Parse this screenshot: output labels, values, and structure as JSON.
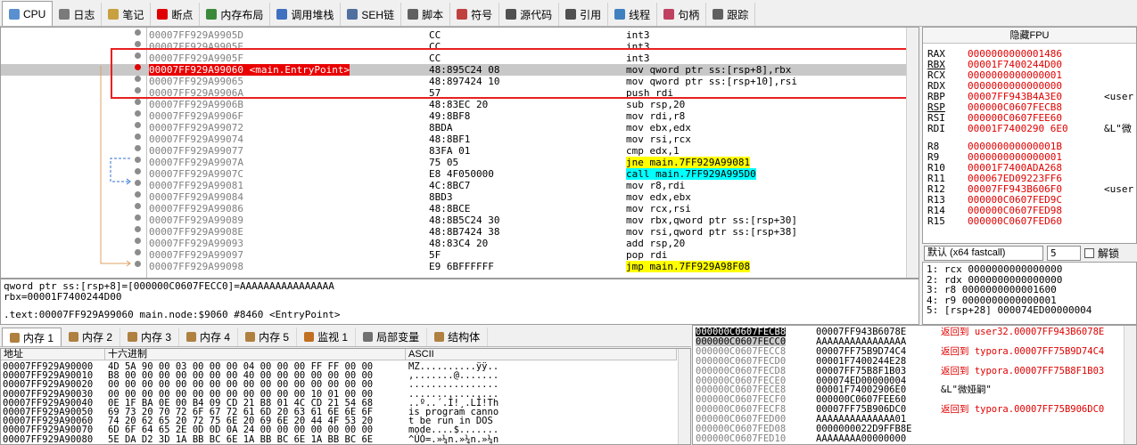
{
  "tabs": [
    {
      "label": "CPU",
      "icon": "cpu-icon",
      "color": "#5a8fd0"
    },
    {
      "label": "日志",
      "icon": "log-icon",
      "color": "#7a7a7a"
    },
    {
      "label": "笔记",
      "icon": "notes-icon",
      "color": "#c8a040"
    },
    {
      "label": "断点",
      "icon": "breakpoint-icon",
      "color": "#e00000"
    },
    {
      "label": "内存布局",
      "icon": "memory-map-icon",
      "color": "#3a8a3a"
    },
    {
      "label": "调用堆栈",
      "icon": "call-stack-icon",
      "color": "#4070c0"
    },
    {
      "label": "SEH链",
      "icon": "seh-chain-icon",
      "color": "#5070a0"
    },
    {
      "label": "脚本",
      "icon": "script-icon",
      "color": "#606060"
    },
    {
      "label": "符号",
      "icon": "symbols-icon",
      "color": "#c04040"
    },
    {
      "label": "源代码",
      "icon": "source-icon",
      "color": "#505050"
    },
    {
      "label": "引用",
      "icon": "references-icon",
      "color": "#505050"
    },
    {
      "label": "线程",
      "icon": "threads-icon",
      "color": "#4080c0"
    },
    {
      "label": "句柄",
      "icon": "handles-icon",
      "color": "#c04060"
    },
    {
      "label": "跟踪",
      "icon": "trace-icon",
      "color": "#606060"
    }
  ],
  "disasm": [
    {
      "addr": "00007FF929A9905D",
      "bytes": "CC",
      "instr": "int3"
    },
    {
      "addr": "00007FF929A9905E",
      "bytes": "CC",
      "instr": "int3"
    },
    {
      "addr": "00007FF929A9905F",
      "bytes": "CC",
      "instr": "int3"
    },
    {
      "addr": "00007FF929A99060 <main.EntryPoint>",
      "bytes": "48:895C24 08",
      "instr": "mov qword ptr ss:[rsp+8],rbx",
      "current": true,
      "bp": "red"
    },
    {
      "addr": "00007FF929A99065",
      "bytes": "48:897424 10",
      "instr": "mov qword ptr ss:[rsp+10],rsi"
    },
    {
      "addr": "00007FF929A9906A",
      "bytes": "57",
      "instr": "push rdi"
    },
    {
      "addr": "00007FF929A9906B",
      "bytes": "48:83EC 20",
      "instr": "sub rsp,20"
    },
    {
      "addr": "00007FF929A9906F",
      "bytes": "49:8BF8",
      "instr": "mov rdi,r8"
    },
    {
      "addr": "00007FF929A99072",
      "bytes": "8BDA",
      "instr": "mov ebx,edx"
    },
    {
      "addr": "00007FF929A99074",
      "bytes": "48:8BF1",
      "instr": "mov rsi,rcx"
    },
    {
      "addr": "00007FF929A99077",
      "bytes": "83FA 01",
      "instr": "cmp edx,1"
    },
    {
      "addr": "00007FF929A9907A",
      "bytes": "75 05",
      "instr": "jne main.7FF929A99081",
      "jump": true
    },
    {
      "addr": "00007FF929A9907C",
      "bytes": "E8 4F050000",
      "instr": "call main.7FF929A995D0",
      "call": true
    },
    {
      "addr": "00007FF929A99081",
      "bytes": "4C:8BC7",
      "instr": "mov r8,rdi"
    },
    {
      "addr": "00007FF929A99084",
      "bytes": "8BD3",
      "instr": "mov edx,ebx"
    },
    {
      "addr": "00007FF929A99086",
      "bytes": "48:8BCE",
      "instr": "mov rcx,rsi"
    },
    {
      "addr": "00007FF929A99089",
      "bytes": "48:8B5C24 30",
      "instr": "mov rbx,qword ptr ss:[rsp+30]"
    },
    {
      "addr": "00007FF929A9908E",
      "bytes": "48:8B7424 38",
      "instr": "mov rsi,qword ptr ss:[rsp+38]"
    },
    {
      "addr": "00007FF929A99093",
      "bytes": "48:83C4 20",
      "instr": "add rsp,20"
    },
    {
      "addr": "00007FF929A99097",
      "bytes": "5F",
      "instr": "pop rdi"
    },
    {
      "addr": "00007FF929A99098",
      "bytes": "E9 6BFFFFFF",
      "instr": "jmp main.7FF929A98F08",
      "jump": true
    }
  ],
  "info": {
    "line1": "qword ptr ss:[rsp+8]=[000000C0607FECC0]=AAAAAAAAAAAAAAAA",
    "line2": "rbx=00001F7400244D00",
    "line3": ".text:00007FF929A99060 main.node:$9060 #8460 <EntryPoint>"
  },
  "registers": {
    "header": "隐藏FPU",
    "rows": [
      {
        "name": "RAX",
        "value": "0000000000001486",
        "comment": ""
      },
      {
        "name": "RBX",
        "value": "00001F7400244D00",
        "comment": ""
      },
      {
        "name": "RCX",
        "value": "0000000000000001",
        "comment": ""
      },
      {
        "name": "RDX",
        "value": "0000000000000000",
        "comment": ""
      },
      {
        "name": "RBP",
        "value": "00007FF943B4A3E0",
        "comment": "<user"
      },
      {
        "name": "RSP",
        "value": "000000C0607FECB8",
        "comment": ""
      },
      {
        "name": "RSI",
        "value": "000000C0607FEE60",
        "comment": ""
      },
      {
        "name": "RDI",
        "value": "00001F7400290 6E0",
        "comment": "&L\"微"
      },
      {
        "name": "R8",
        "value": "000000000000001B",
        "comment": ""
      },
      {
        "name": "R9",
        "value": "0000000000000001",
        "comment": ""
      },
      {
        "name": "R10",
        "value": "00001F7400ADA268",
        "comment": ""
      },
      {
        "name": "R11",
        "value": "000067ED09223FF6",
        "comment": ""
      },
      {
        "name": "R12",
        "value": "00007FF943B606F0",
        "comment": "<user"
      },
      {
        "name": "R13",
        "value": "000000C0607FED9C",
        "comment": ""
      },
      {
        "name": "R14",
        "value": "000000C0607FED98",
        "comment": ""
      },
      {
        "name": "R15",
        "value": "000000C0607FED60",
        "comment": ""
      }
    ]
  },
  "callconv": {
    "value": "默认 (x64 fastcall)",
    "count": "5",
    "unlock": "解锁"
  },
  "args": [
    "1: rcx 0000000000000000",
    "2: rdx 0000000000000000",
    "3: r8 0000000000001600",
    "4: r9 0000000000000001",
    "5: [rsp+28] 000074ED00000004"
  ],
  "bottom_tabs": [
    {
      "label": "内存 1",
      "icon": "memory-icon"
    },
    {
      "label": "内存 2",
      "icon": "memory-icon"
    },
    {
      "label": "内存 3",
      "icon": "memory-icon"
    },
    {
      "label": "内存 4",
      "icon": "memory-icon"
    },
    {
      "label": "内存 5",
      "icon": "memory-icon"
    },
    {
      "label": "监视 1",
      "icon": "watch-icon"
    },
    {
      "label": "局部变量",
      "icon": "locals-icon"
    },
    {
      "label": "结构体",
      "icon": "struct-icon"
    }
  ],
  "hex": {
    "headers": {
      "addr": "地址",
      "hex": "十六进制",
      "ascii": "ASCII"
    },
    "rows": [
      {
        "addr": "00007FF929A90000",
        "bytes": "4D 5A 90 00 03 00 00 00 04 00 00 00 FF FF 00 00",
        "ascii": "MZ..........ÿÿ.."
      },
      {
        "addr": "00007FF929A90010",
        "bytes": "B8 00 00 00 00 00 00 00 40 00 00 00 00 00 00 00",
        "ascii": ",.......@......."
      },
      {
        "addr": "00007FF929A90020",
        "bytes": "00 00 00 00 00 00 00 00 00 00 00 00 00 00 00 00",
        "ascii": "................"
      },
      {
        "addr": "00007FF929A90030",
        "bytes": "00 00 00 00 00 00 00 00 00 00 00 00 10 01 00 00",
        "ascii": "................"
      },
      {
        "addr": "00007FF929A90040",
        "bytes": "0E 1F BA 0E 00 B4 09 CD 21 B8 01 4C CD 21 54 68",
        "ascii": "..º..´.Í!¸.LÍ!Th"
      },
      {
        "addr": "00007FF929A90050",
        "bytes": "69 73 20 70 72 6F 67 72 61 6D 20 63 61 6E 6E 6F",
        "ascii": "is program canno"
      },
      {
        "addr": "00007FF929A90060",
        "bytes": "74 20 62 65 20 72 75 6E 20 69 6E 20 44 4F 53 20",
        "ascii": "t be run in DOS "
      },
      {
        "addr": "00007FF929A90070",
        "bytes": "6D 6F 64 65 2E 0D 0D 0A 24 00 00 00 00 00 00 00",
        "ascii": "mode....$......."
      },
      {
        "addr": "00007FF929A90080",
        "bytes": "5E DA D2 3D 1A BB BC 6E 1A BB BC 6E 1A BB BC 6E",
        "ascii": "^ÚÒ=.»¼n.»¼n.»¼n"
      }
    ]
  },
  "stack": [
    {
      "addr": "000000C0607FECB8",
      "value": "00007FF943B6078E",
      "comment": "返回到 user32.00007FF943B6078E"
    },
    {
      "addr": "000000C0607FECC0",
      "value": "AAAAAAAAAAAAAAAA",
      "comment": ""
    },
    {
      "addr": "000000C0607FECC8",
      "value": "00007FF75B9D74C4",
      "comment": "返回到 typora.00007FF75B9D74C4"
    },
    {
      "addr": "000000C0607FECD0",
      "value": "00001F7400244E28",
      "comment": ""
    },
    {
      "addr": "000000C0607FECD8",
      "value": "00007FF75B8F1B03",
      "comment": "返回到 typora.00007FF75B8F1B03"
    },
    {
      "addr": "000000C0607FECE0",
      "value": "000074ED00000004",
      "comment": ""
    },
    {
      "addr": "000000C0607FECE8",
      "value": "00001F74002906E0",
      "comment": "&L\"微娅嗣\""
    },
    {
      "addr": "000000C0607FECF0",
      "value": "000000C0607FEE60",
      "comment": ""
    },
    {
      "addr": "000000C0607FECF8",
      "value": "00007FF75B906DC0",
      "comment": "返回到 typora.00007FF75B906DC0"
    },
    {
      "addr": "000000C0607FED00",
      "value": "AAAAAAAAAAAAAA01",
      "comment": ""
    },
    {
      "addr": "000000C0607FED08",
      "value": "0000000022D9FFB8E",
      "comment": ""
    },
    {
      "addr": "000000C0607FED10",
      "value": "AAAAAAAA00000000",
      "comment": ""
    }
  ]
}
